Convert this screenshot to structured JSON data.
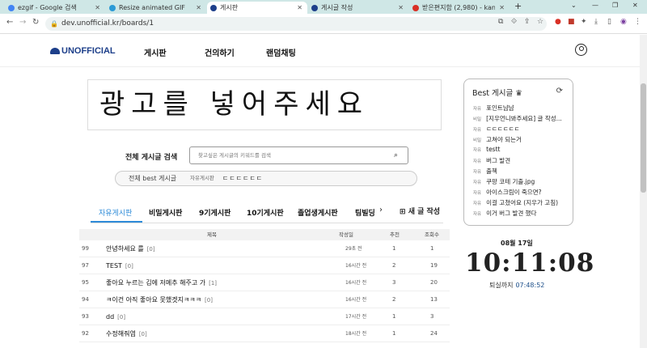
{
  "browser": {
    "tabs": [
      {
        "title": "ezgif - Google 검색",
        "icon_color": "#4285f4"
      },
      {
        "title": "Resize animated GIF",
        "icon_color": "#2b9ad6"
      },
      {
        "title": "게시판",
        "icon_color": "#1d3f8a"
      },
      {
        "title": "게시글 작성",
        "icon_color": "#1d3f8a"
      },
      {
        "title": "받은편지함 (2,980) - kanghee96",
        "icon_color": "#d93025"
      }
    ],
    "url": "dev.unofficial.kr/boards/1"
  },
  "header": {
    "logo": "UNOFFICIAL",
    "menu": [
      "게시판",
      "건의하기",
      "랜덤채팅"
    ]
  },
  "ad_text": "광고를 넣어주세요",
  "search": {
    "label": "전체 게시글 검색",
    "placeholder": "찾고싶은 게시글의 키워드를 검색"
  },
  "best_bar": {
    "label": "전체 best 게시글",
    "board": "자유게시판",
    "title": "ㄷㄷㄷㄷㄷㄷ"
  },
  "board_tabs": [
    "자유게시판",
    "비밀게시판",
    "9기게시판",
    "10기게시판",
    "졸업생게시판",
    "팀빌딩"
  ],
  "write_label": "새 글 작성",
  "table": {
    "headers": {
      "title": "제목",
      "date": "작성일",
      "rec": "추천",
      "views": "조회수"
    },
    "rows": [
      {
        "num": "99",
        "title": "안녕하세요 를",
        "comments": "[0]",
        "date": "29초 전",
        "rec": "1",
        "views": "1"
      },
      {
        "num": "97",
        "title": "TEST",
        "comments": "[0]",
        "date": "16시간 전",
        "rec": "2",
        "views": "19"
      },
      {
        "num": "95",
        "title": "좋아요 누르는 김에 저메추 해주고 가",
        "comments": "[1]",
        "date": "16시간 전",
        "rec": "3",
        "views": "20"
      },
      {
        "num": "94",
        "title": "ㅋ이건 아직 좋아요 못했겟지ㅋㅋㅋ",
        "comments": "[0]",
        "date": "16시간 전",
        "rec": "2",
        "views": "13"
      },
      {
        "num": "93",
        "title": "dd",
        "comments": "[0]",
        "date": "17시간 전",
        "rec": "1",
        "views": "3"
      },
      {
        "num": "92",
        "title": "수정해줘염",
        "comments": "[0]",
        "date": "18시간 전",
        "rec": "1",
        "views": "24"
      }
    ]
  },
  "best_side": {
    "title": "Best 게시글 ♛",
    "items": [
      {
        "board": "자유",
        "title": "포인트냠냠"
      },
      {
        "board": "비밀",
        "title": "[지우언니봐주세요] 글 작성..."
      },
      {
        "board": "자유",
        "title": "ㄷㄷㄷㄷㄷㄷ"
      },
      {
        "board": "비밀",
        "title": "고쳐야 되는거"
      },
      {
        "board": "자유",
        "title": "testt"
      },
      {
        "board": "자유",
        "title": "버그 발견"
      },
      {
        "board": "자유",
        "title": "출첵"
      },
      {
        "board": "자유",
        "title": "쿠팡 코테 기출.jpg"
      },
      {
        "board": "자유",
        "title": "아이스크림이 죽으면?"
      },
      {
        "board": "자유",
        "title": "이걸 고쳤어요 (지우가 고침)"
      },
      {
        "board": "자유",
        "title": "이거 버그 발견 했다"
      }
    ]
  },
  "clock": {
    "date": "08월 17일",
    "time": "10:11:08",
    "remain_label": "퇴실까지",
    "remain": "07:48:52"
  }
}
